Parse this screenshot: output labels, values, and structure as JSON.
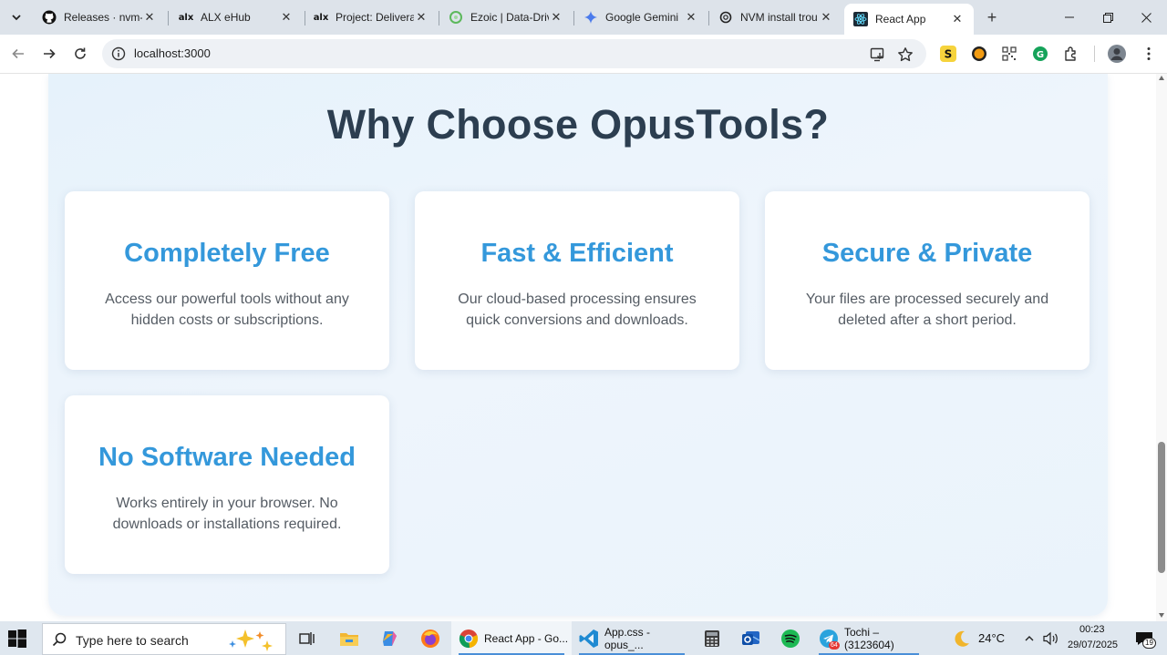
{
  "browser": {
    "tabs": [
      {
        "title": "Releases · nvm-s",
        "icon": "github-icon"
      },
      {
        "title": "ALX eHub",
        "icon": "alx-icon"
      },
      {
        "title": "Project: Delivera",
        "icon": "alx-icon"
      },
      {
        "title": "Ezoic | Data-Driv",
        "icon": "ezoic-icon"
      },
      {
        "title": "Google Gemini",
        "icon": "gemini-icon"
      },
      {
        "title": "NVM install trou",
        "icon": "openai-icon"
      },
      {
        "title": "React App",
        "icon": "react-icon"
      }
    ],
    "active_tab_index": 6,
    "url": "localhost:3000"
  },
  "page": {
    "heading": "Why Choose OpusTools?",
    "cards": [
      {
        "title": "Completely Free",
        "text": "Access our powerful tools without any hidden costs or subscriptions."
      },
      {
        "title": "Fast & Efficient",
        "text": "Our cloud-based processing ensures quick conversions and downloads."
      },
      {
        "title": "Secure & Private",
        "text": "Your files are processed securely and deleted after a short period."
      },
      {
        "title": "No Software Needed",
        "text": "Works entirely in your browser. No downloads or installations required."
      }
    ],
    "colors": {
      "heading": "#2c3e50",
      "card_title": "#3498db",
      "card_text": "#555c64"
    }
  },
  "taskbar": {
    "search_placeholder": "Type here to search",
    "apps": [
      {
        "label": "React App - Go...",
        "icon": "chrome-icon"
      },
      {
        "label": "App.css - opus_...",
        "icon": "vscode-icon"
      },
      {
        "label": "Tochi – (3123604)",
        "icon": "telegram-icon"
      }
    ],
    "telegram_badge": "64",
    "weather": "24°C",
    "time": "00:23",
    "date": "29/07/2025",
    "notifications": "19"
  }
}
